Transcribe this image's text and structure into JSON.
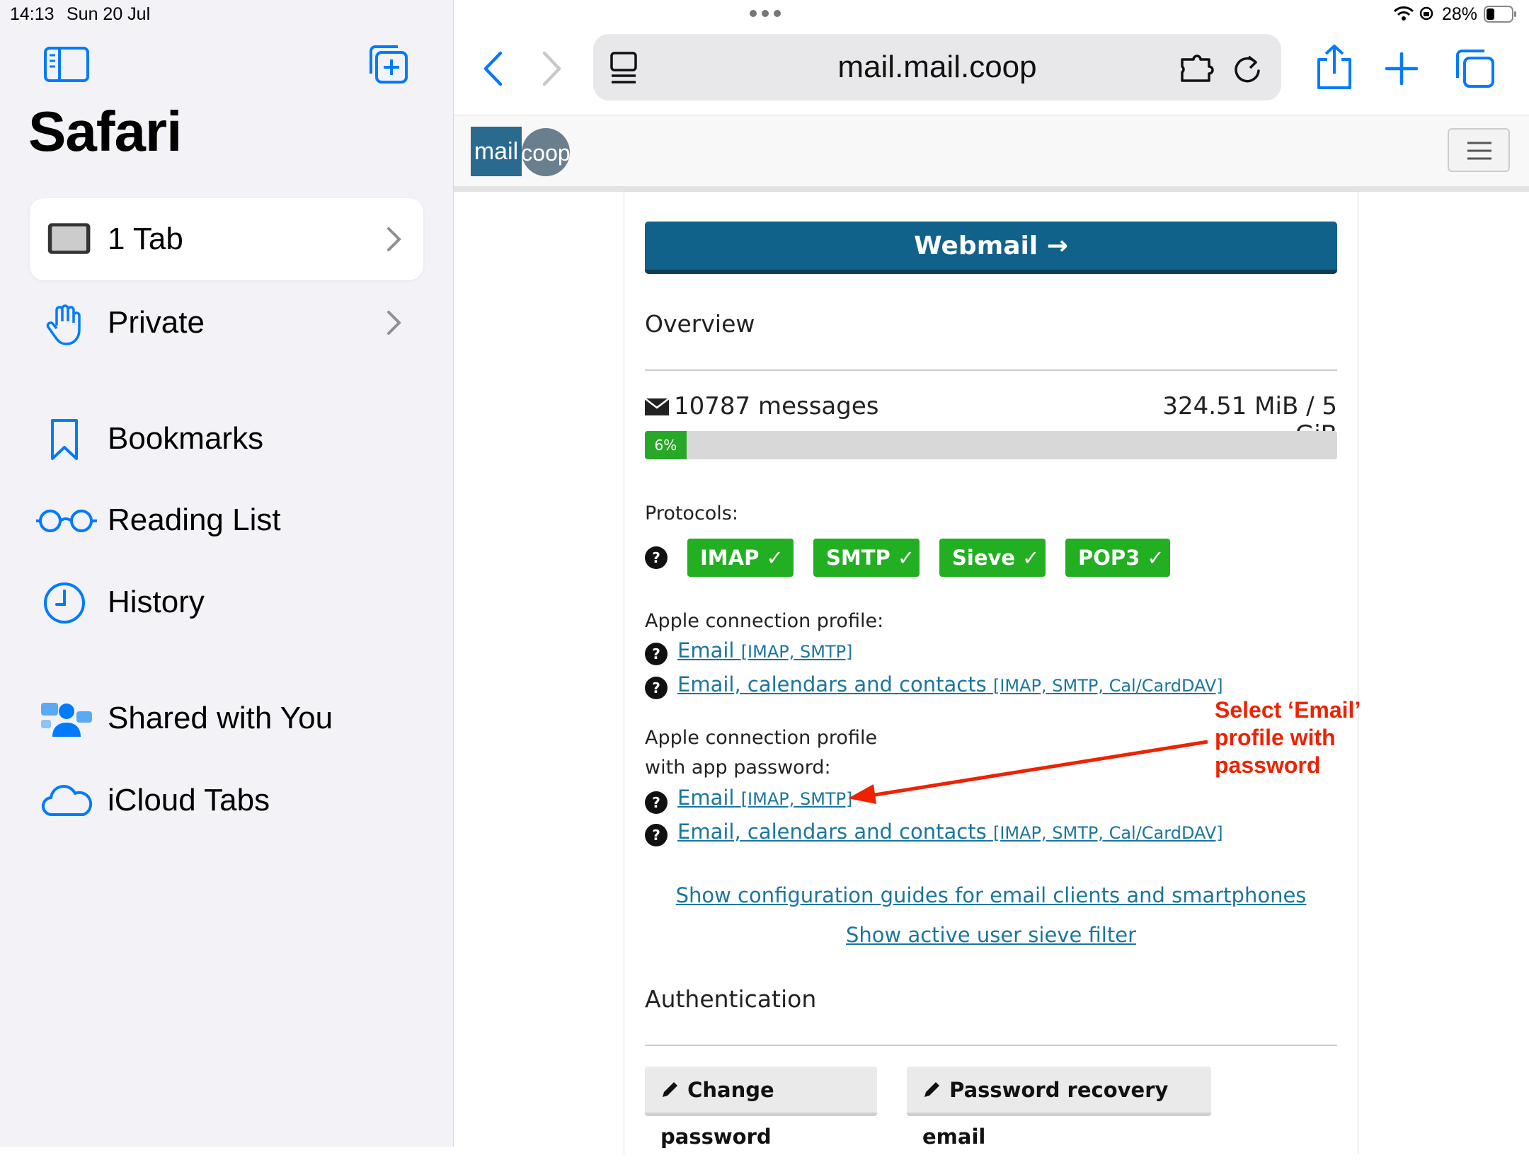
{
  "status_bar": {
    "time": "14:13",
    "date": "Sun 20 Jul",
    "battery": "28%"
  },
  "sidebar": {
    "title": "Safari",
    "items": [
      {
        "label": "1 Tab"
      },
      {
        "label": "Private"
      },
      {
        "label": "Bookmarks"
      },
      {
        "label": "Reading List"
      },
      {
        "label": "History"
      },
      {
        "label": "Shared with You"
      },
      {
        "label": "iCloud Tabs"
      }
    ]
  },
  "toolbar": {
    "url": "mail.mail.coop"
  },
  "site": {
    "logo_left": "mail",
    "logo_right": "coop"
  },
  "content": {
    "webmail_label": "Webmail →",
    "overview_heading": "Overview",
    "messages": "10787 messages",
    "storage": "324.51 MiB / 5 GiB",
    "usage_percent": 6,
    "usage_label": "6%",
    "protocols_label": "Protocols:",
    "protocols": [
      "IMAP ✓",
      "SMTP ✓",
      "Sieve ✓",
      "POP3 ✓"
    ],
    "help_glyph": "?",
    "apple_profile_label": "Apple connection profile:",
    "apple_profile_app_label_1": "Apple connection profile",
    "apple_profile_app_label_2": "with app password:",
    "link_email": "Email",
    "link_email_tag": "[IMAP, SMTP]",
    "link_full": "Email, calendars and contacts",
    "link_full_tag": "[IMAP, SMTP, Cal/CardDAV]",
    "show_guides": "Show configuration guides for email clients and smartphones",
    "show_sieve": "Show active user sieve filter",
    "auth_heading": "Authentication",
    "change_password": "Change password",
    "recovery_email": "Password recovery email"
  },
  "annotation": {
    "line1": "Select ‘Email’",
    "line2": "profile with",
    "line3": "password",
    "color": "#ee2200"
  },
  "colors": {
    "accent": "#007aff",
    "webmail": "#11628b",
    "badge_green": "#22b022",
    "link": "#1a76a0"
  }
}
